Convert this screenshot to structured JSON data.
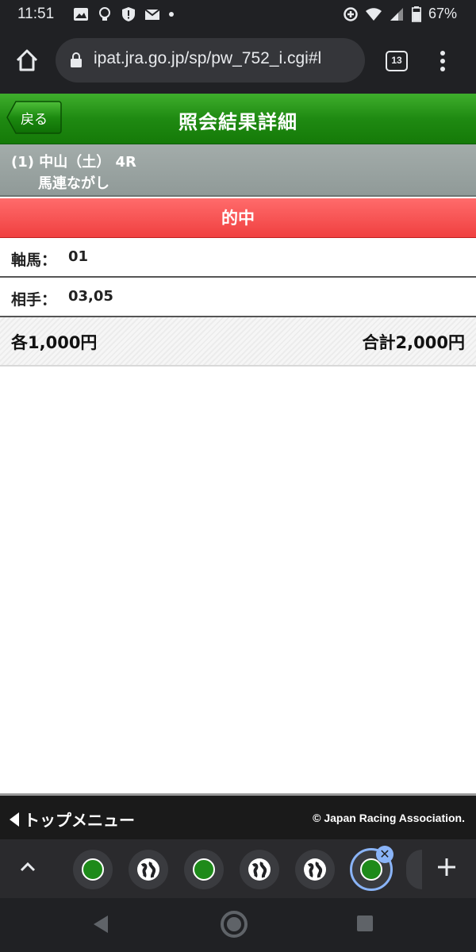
{
  "status_bar": {
    "time": "11:51",
    "battery": "67%"
  },
  "browser": {
    "url": "ipat.jra.go.jp/sp/pw_752_i.cgi#l",
    "tab_count": "13"
  },
  "header": {
    "back_label": "戻る",
    "title": "照会結果詳細"
  },
  "race": {
    "line1": "(1) 中山（土） 4R",
    "line2": "馬連ながし"
  },
  "result": {
    "status": "的中"
  },
  "axis_horse": {
    "label": "軸馬：",
    "value": "01"
  },
  "partner": {
    "label": "相手：",
    "value": "03,05"
  },
  "amount": {
    "each": "各1,000円",
    "total": "合計2,000円"
  },
  "footer": {
    "top_menu": "トップメニュー",
    "copyright": "© Japan Racing Association."
  },
  "tab_strip": {
    "close_glyph": "✕"
  },
  "colors": {
    "header_green": "#1f8a12",
    "hit_red": "#f04040",
    "race_gray": "#909a98",
    "active_tab_blue": "#8ab4f8"
  }
}
